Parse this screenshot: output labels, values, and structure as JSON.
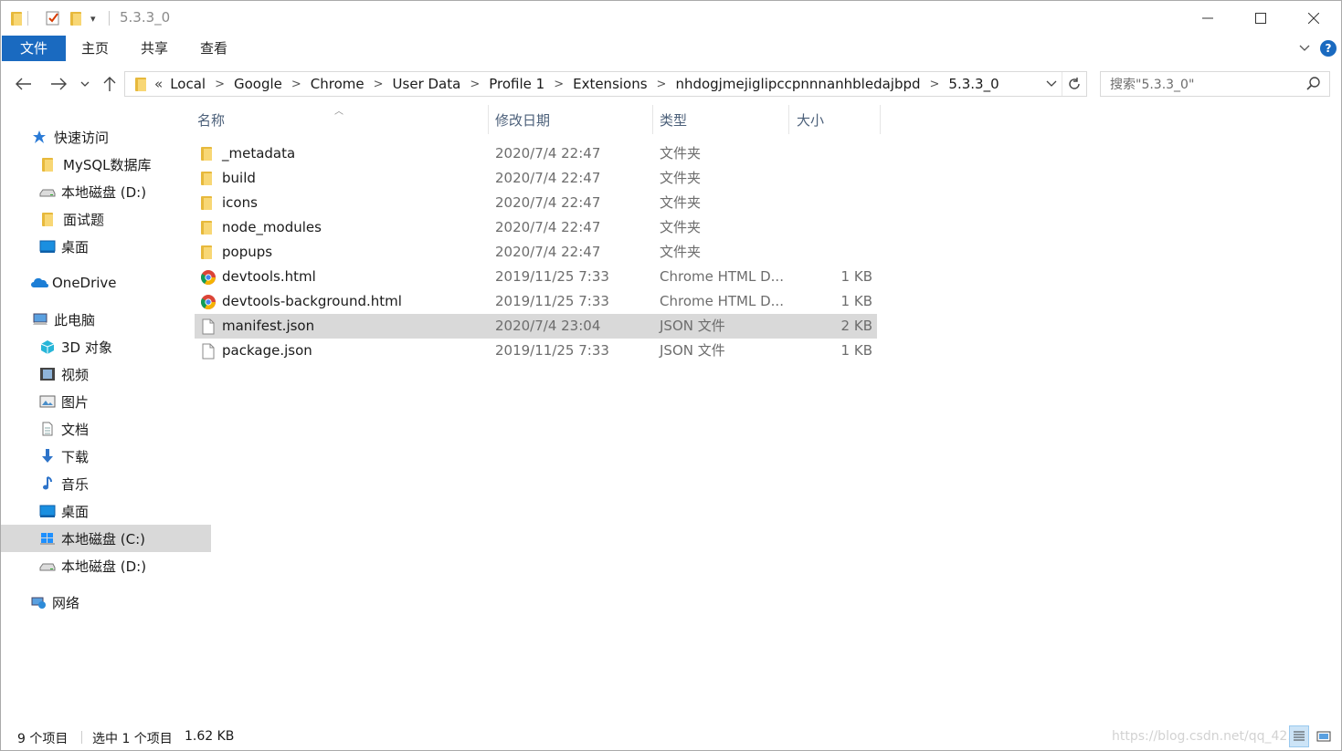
{
  "window": {
    "title": "5.3.3_0",
    "controls": {
      "minimize": "—",
      "maximize": "☐",
      "close": "✕"
    }
  },
  "ribbon": {
    "tabs": [
      "文件",
      "主页",
      "共享",
      "查看"
    ]
  },
  "address": {
    "overflow": "«",
    "crumbs": [
      "Local",
      "Google",
      "Chrome",
      "User Data",
      "Profile 1",
      "Extensions",
      "nhdogjmejiglipccpnnnanhbledajbpd",
      "5.3.3_0"
    ]
  },
  "search": {
    "placeholder": "搜索\"5.3.3_0\""
  },
  "nav": {
    "items": [
      {
        "label": "快速访问",
        "icon": "star-icon"
      },
      {
        "label": "MySQL数据库",
        "icon": "folder-icon"
      },
      {
        "label": "本地磁盘 (D:)",
        "icon": "drive-icon"
      },
      {
        "label": "面试题",
        "icon": "folder-icon"
      },
      {
        "label": "桌面",
        "icon": "desktop-icon"
      },
      {
        "label": "OneDrive",
        "icon": "cloud-icon"
      },
      {
        "label": "此电脑",
        "icon": "computer-icon"
      },
      {
        "label": "3D 对象",
        "icon": "cube-icon"
      },
      {
        "label": "视频",
        "icon": "video-icon"
      },
      {
        "label": "图片",
        "icon": "picture-icon"
      },
      {
        "label": "文档",
        "icon": "document-icon"
      },
      {
        "label": "下载",
        "icon": "download-icon"
      },
      {
        "label": "音乐",
        "icon": "music-icon"
      },
      {
        "label": "桌面",
        "icon": "desktop-icon"
      },
      {
        "label": "本地磁盘 (C:)",
        "icon": "windows-drive-icon"
      },
      {
        "label": "本地磁盘 (D:)",
        "icon": "drive-icon"
      },
      {
        "label": "网络",
        "icon": "network-icon"
      }
    ]
  },
  "columns": {
    "name": "名称",
    "date": "修改日期",
    "type": "类型",
    "size": "大小"
  },
  "files": [
    {
      "name": "_metadata",
      "date": "2020/7/4 22:47",
      "type": "文件夹",
      "size": "",
      "icon": "folder-icon"
    },
    {
      "name": "build",
      "date": "2020/7/4 22:47",
      "type": "文件夹",
      "size": "",
      "icon": "folder-icon"
    },
    {
      "name": "icons",
      "date": "2020/7/4 22:47",
      "type": "文件夹",
      "size": "",
      "icon": "folder-icon"
    },
    {
      "name": "node_modules",
      "date": "2020/7/4 22:47",
      "type": "文件夹",
      "size": "",
      "icon": "folder-icon"
    },
    {
      "name": "popups",
      "date": "2020/7/4 22:47",
      "type": "文件夹",
      "size": "",
      "icon": "folder-icon"
    },
    {
      "name": "devtools.html",
      "date": "2019/11/25 7:33",
      "type": "Chrome HTML D...",
      "size": "1 KB",
      "icon": "chrome-icon"
    },
    {
      "name": "devtools-background.html",
      "date": "2019/11/25 7:33",
      "type": "Chrome HTML D...",
      "size": "1 KB",
      "icon": "chrome-icon"
    },
    {
      "name": "manifest.json",
      "date": "2020/7/4 23:04",
      "type": "JSON 文件",
      "size": "2 KB",
      "icon": "file-icon"
    },
    {
      "name": "package.json",
      "date": "2019/11/25 7:33",
      "type": "JSON 文件",
      "size": "1 KB",
      "icon": "file-icon"
    }
  ],
  "status": {
    "count": "9 个项目",
    "selected": "选中 1 个项目",
    "size": "1.62 KB"
  },
  "watermark": "https://blog.csdn.net/qq_42..."
}
